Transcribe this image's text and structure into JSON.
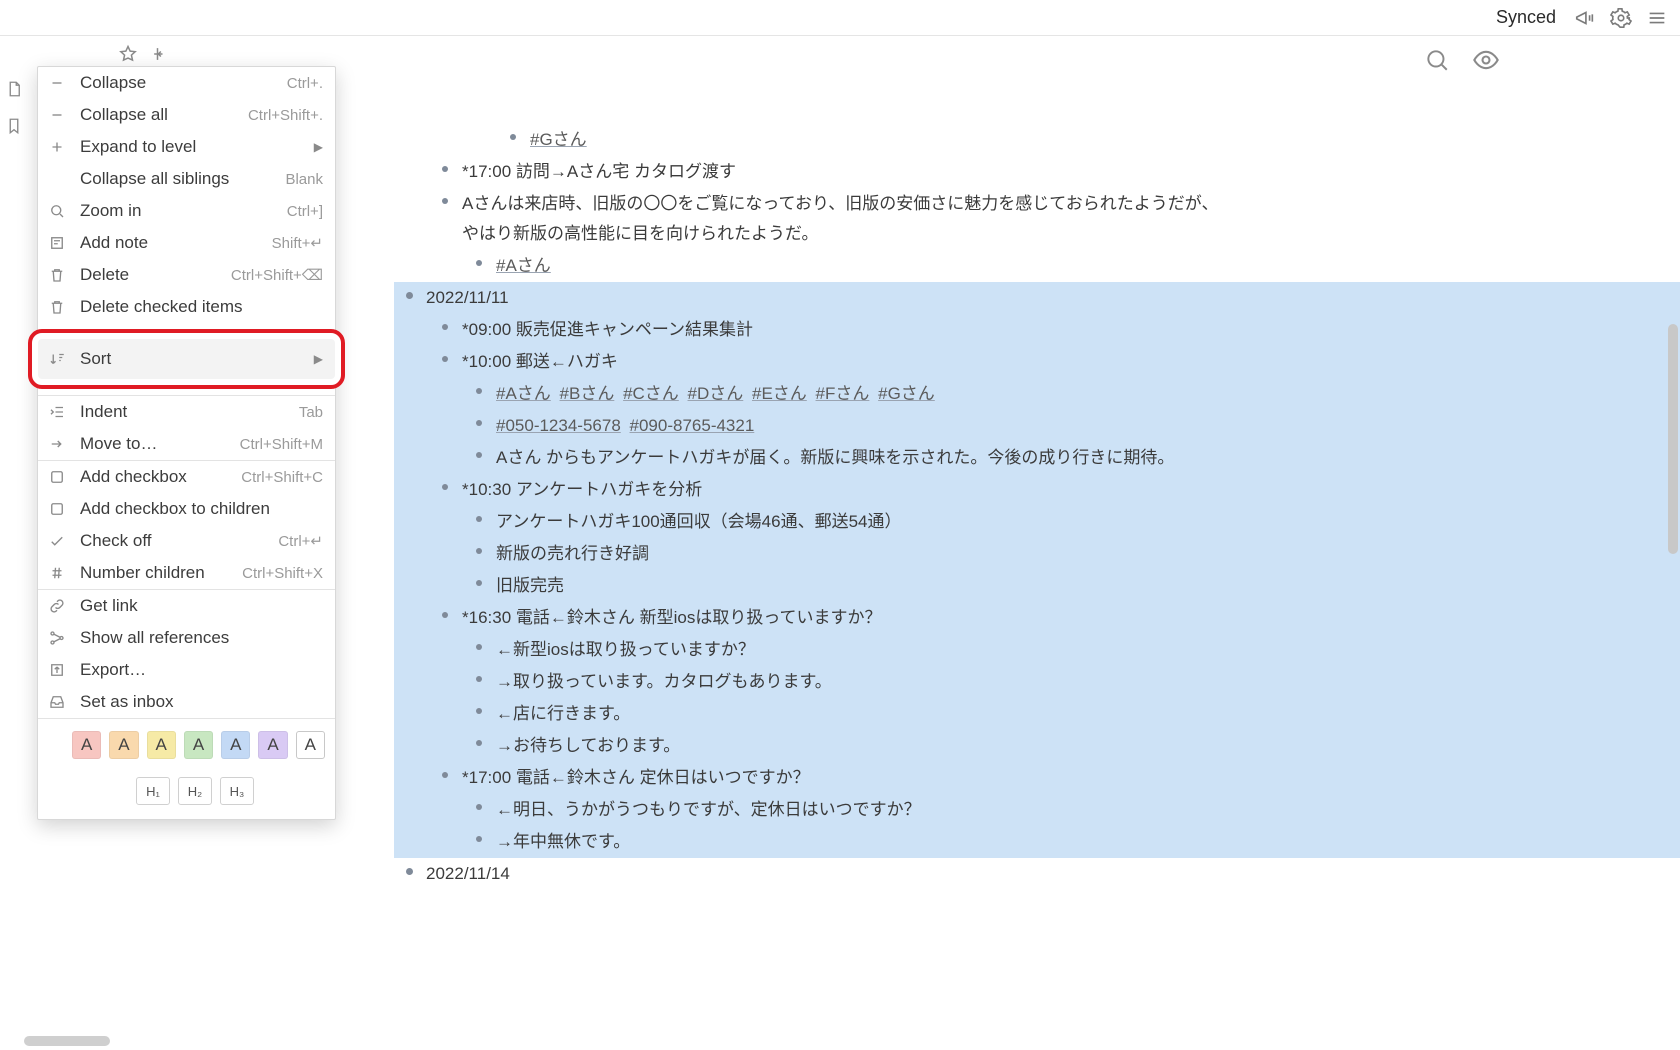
{
  "topbar": {
    "synced": "Synced"
  },
  "menu": {
    "collapse": "Collapse",
    "collapse_sc": "Ctrl+.",
    "collapse_all": "Collapse all",
    "collapse_all_sc": "Ctrl+Shift+.",
    "expand_to_level": "Expand to level",
    "collapse_siblings": "Collapse all siblings",
    "collapse_siblings_sc": "Blank",
    "zoom_in": "Zoom in",
    "zoom_in_sc": "Ctrl+]",
    "add_note": "Add note",
    "add_note_sc": "Shift+↵",
    "delete": "Delete",
    "delete_sc": "Ctrl+Shift+⌫",
    "delete_checked": "Delete checked items",
    "sort": "Sort",
    "indent": "Indent",
    "indent_sc": "Tab",
    "move_to": "Move to…",
    "move_to_sc": "Ctrl+Shift+M",
    "add_checkbox": "Add checkbox",
    "add_checkbox_sc": "Ctrl+Shift+C",
    "add_checkbox_children": "Add checkbox to children",
    "check_off": "Check off",
    "check_off_sc": "Ctrl+↵",
    "number_children": "Number children",
    "number_children_sc": "Ctrl+Shift+X",
    "get_link": "Get link",
    "show_refs": "Show all references",
    "export": "Export…",
    "set_inbox": "Set as inbox"
  },
  "swatch_label": "A",
  "swatch_colors": [
    "#f7c6c1",
    "#f9d9ad",
    "#f6eaa6",
    "#c8e7c1",
    "#c3d9f5",
    "#d9caf4",
    "#ffffff"
  ],
  "headings": [
    "H₁",
    "H₂",
    "H₃"
  ],
  "content": {
    "top_tag_g": "#Gさん",
    "l1700": "*17:00 訪問→Aさん宅 カタログ渡す",
    "a_note": "Aさんは来店時、旧版の〇〇をご覧になっており、旧版の安価さに魅力を感じておられたようだが、やはり新版の高性能に目を向けられたようだ。",
    "a_tag": "#Aさん",
    "d11": "2022/11/11",
    "d11_0900": "*09:00 販売促進キャンペーン結果集計",
    "d11_1000": "*10:00 郵送←ハガキ",
    "persons": [
      "#Aさん",
      "#Bさん",
      "#Cさん",
      "#Dさん",
      "#Eさん",
      "#Fさん",
      "#Gさん"
    ],
    "phones": [
      "#050-1234-5678",
      "#090-8765-4321"
    ],
    "d11_1000_note": "Aさん からもアンケートハガキが届く。新版に興味を示された。今後の成り行きに期待。",
    "d11_1030": "*10:30 アンケートハガキを分析",
    "d11_1030_a": "アンケートハガキ100通回収（会場46通、郵送54通）",
    "d11_1030_b": "新版の売れ行き好調",
    "d11_1030_c": "旧版完売",
    "d11_1630": "*16:30 電話←鈴木さん 新型iosは取り扱っていますか？",
    "d11_1630_a": "←新型iosは取り扱っていますか？",
    "d11_1630_b": "→取り扱っています。カタログもあります。",
    "d11_1630_c": "←店に行きます。",
    "d11_1630_d": "→お待ちしております。",
    "d11_1700": "*17:00 電話←鈴木さん 定休日はいつですか？",
    "d11_1700_a": "←明日、うかがうつもりですが、定休日はいつですか？",
    "d11_1700_b": "→年中無休です。",
    "d14": "2022/11/14"
  }
}
